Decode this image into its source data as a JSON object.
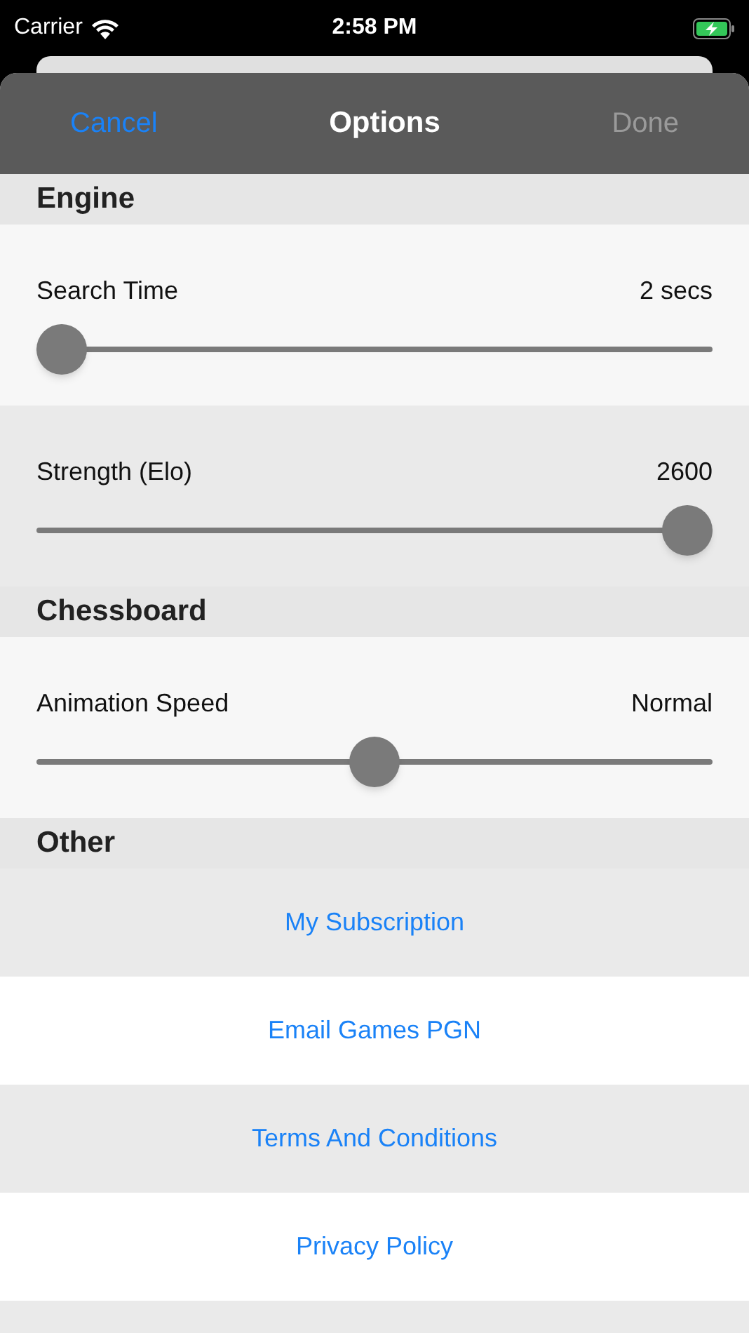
{
  "status_bar": {
    "carrier": "Carrier",
    "time": "2:58 PM",
    "charging": true
  },
  "nav": {
    "cancel": {
      "label": "Cancel",
      "disabled": false
    },
    "title": "Options",
    "done": {
      "label": "Done",
      "disabled": true
    }
  },
  "sections": [
    {
      "title": "Engine",
      "rows": [
        {
          "kind": "slider",
          "label": "Search Time",
          "reading": "2 secs",
          "level": 0
        },
        {
          "kind": "slider",
          "label": "Strength (Elo)",
          "reading": "2600",
          "level": 1
        }
      ]
    },
    {
      "title": "Chessboard",
      "rows": [
        {
          "kind": "slider",
          "label": "Animation Speed",
          "reading": "Normal",
          "level": 0.5
        }
      ]
    },
    {
      "title": "Other",
      "rows": [
        {
          "kind": "link",
          "label": "My Subscription"
        },
        {
          "kind": "link",
          "label": "Email Games PGN"
        },
        {
          "kind": "link",
          "label": "Terms And Conditions"
        },
        {
          "kind": "link",
          "label": "Privacy Policy"
        }
      ]
    }
  ]
}
